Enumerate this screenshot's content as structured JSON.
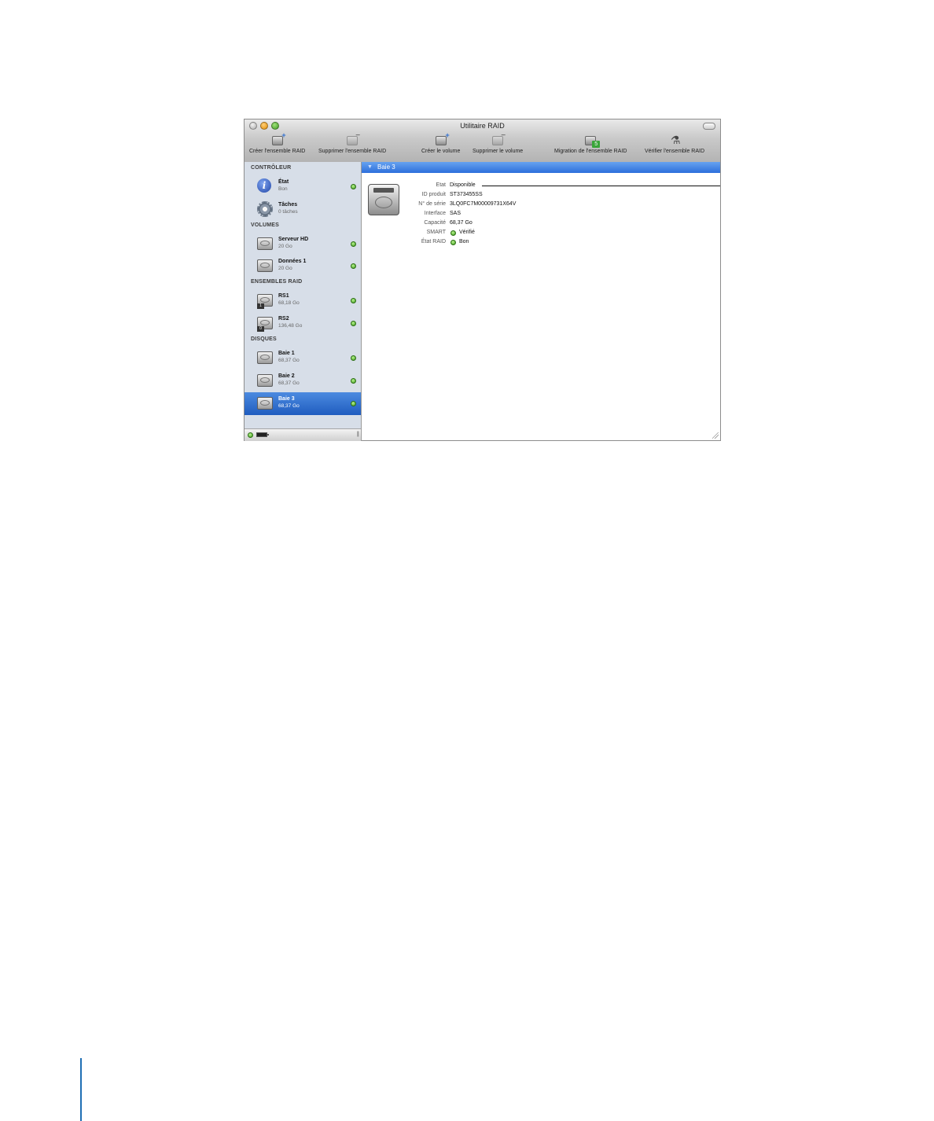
{
  "window": {
    "title": "Utilitaire RAID"
  },
  "toolbar": [
    {
      "label": "Créer l'ensemble RAID",
      "icon": "create-raid-icon"
    },
    {
      "label": "Supprimer l'ensemble RAID",
      "icon": "delete-raid-icon"
    },
    {
      "label": "Créer le volume",
      "icon": "create-volume-icon"
    },
    {
      "label": "Supprimer le volume",
      "icon": "delete-volume-icon"
    },
    {
      "label": "Migration de l'ensemble RAID",
      "icon": "migrate-raid-icon"
    },
    {
      "label": "Vérifier l'ensemble RAID",
      "icon": "microscope-icon"
    }
  ],
  "sidebar": {
    "sections": [
      {
        "title": "CONTRÔLEUR"
      },
      {
        "title": "VOLUMES"
      },
      {
        "title": "ENSEMBLES RAID"
      },
      {
        "title": "DISQUES"
      }
    ],
    "items": [
      {
        "name": "État",
        "sub": "Bon",
        "icon": "info-icon"
      },
      {
        "name": "Tâches",
        "sub": "0 tâches",
        "icon": "gear-icon"
      },
      {
        "name": "Serveur HD",
        "sub": "20 Go",
        "icon": "volume-icon"
      },
      {
        "name": "Données 1",
        "sub": "20 Go",
        "icon": "volume-icon"
      },
      {
        "name": "RS1",
        "sub": "68,18 Go",
        "icon": "raid-set-icon",
        "tag": "1"
      },
      {
        "name": "RS2",
        "sub": "136,48 Go",
        "icon": "raid-set-icon",
        "tag": "0"
      },
      {
        "name": "Baie 1",
        "sub": "68,37 Go",
        "icon": "disk-icon"
      },
      {
        "name": "Baie 2",
        "sub": "68,37 Go",
        "icon": "disk-icon"
      },
      {
        "name": "Baie 3",
        "sub": "68,37 Go",
        "icon": "disk-icon",
        "selected": true
      }
    ],
    "status_color": "#3d9a1c"
  },
  "detail": {
    "title": "Baie 3",
    "properties": [
      {
        "label": "Etat",
        "value": "Disponible"
      },
      {
        "label": "ID produit",
        "value": "ST373455SS"
      },
      {
        "label": "N° de série",
        "value": "3LQ0FC7M00009731X64V"
      },
      {
        "label": "Interface",
        "value": "SAS"
      },
      {
        "label": "Capacité",
        "value": "68,37 Go"
      },
      {
        "label": "SMART",
        "value": "Vérifié",
        "status": true
      },
      {
        "label": "État RAID",
        "value": "Bon",
        "status": true
      }
    ]
  },
  "colors": {
    "selection": "#1f5cbf",
    "header": "#2d6fdc",
    "page_rule": "#1f6fb4"
  }
}
